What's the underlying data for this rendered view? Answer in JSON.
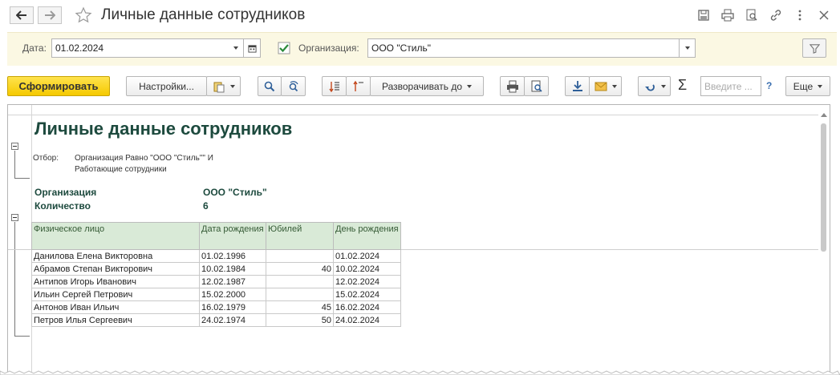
{
  "window": {
    "title": "Личные данные сотрудников"
  },
  "filters": {
    "date_label": "Дата:",
    "date_value": "01.02.2024",
    "org_label": "Организация:",
    "org_value": "ООО \"Стиль\"",
    "org_checked": true
  },
  "toolbar": {
    "generate": "Сформировать",
    "settings": "Настройки...",
    "expand": "Разворачивать до",
    "search_placeholder": "Введите ...",
    "help": "?",
    "more": "Еще"
  },
  "report": {
    "title": "Личные данные сотрудников",
    "filter_label": "Отбор:",
    "filter_line1": "Организация Равно \"ООО \"Стиль\"\" И",
    "filter_line2": "Работающие сотрудники",
    "org_caption": "Организация",
    "org_value": "ООО \"Стиль\"",
    "count_caption": "Количество",
    "count_value": "6",
    "columns": [
      "Физическое лицо",
      "Дата рождения",
      "Юбилей",
      "День рождения"
    ],
    "rows": [
      [
        "Данилова Елена Викторовна",
        "01.02.1996",
        "",
        "01.02.2024"
      ],
      [
        "Абрамов Степан Викторович",
        "10.02.1984",
        "40",
        "10.02.2024"
      ],
      [
        "Антипов Игорь Иванович",
        "12.02.1987",
        "",
        "12.02.2024"
      ],
      [
        "Ильин Сергей Петрович",
        "15.02.2000",
        "",
        "15.02.2024"
      ],
      [
        "Антонов Иван Ильич",
        "16.02.1979",
        "45",
        "16.02.2024"
      ],
      [
        "Петров Илья Сергеевич",
        "24.02.1974",
        "50",
        "24.02.2024"
      ]
    ]
  },
  "colors": {
    "primary_button": "#f5c900",
    "filter_bar_bg": "#fbf8e3",
    "table_header_bg": "#d9ead7",
    "report_title": "#1d4a3e"
  }
}
